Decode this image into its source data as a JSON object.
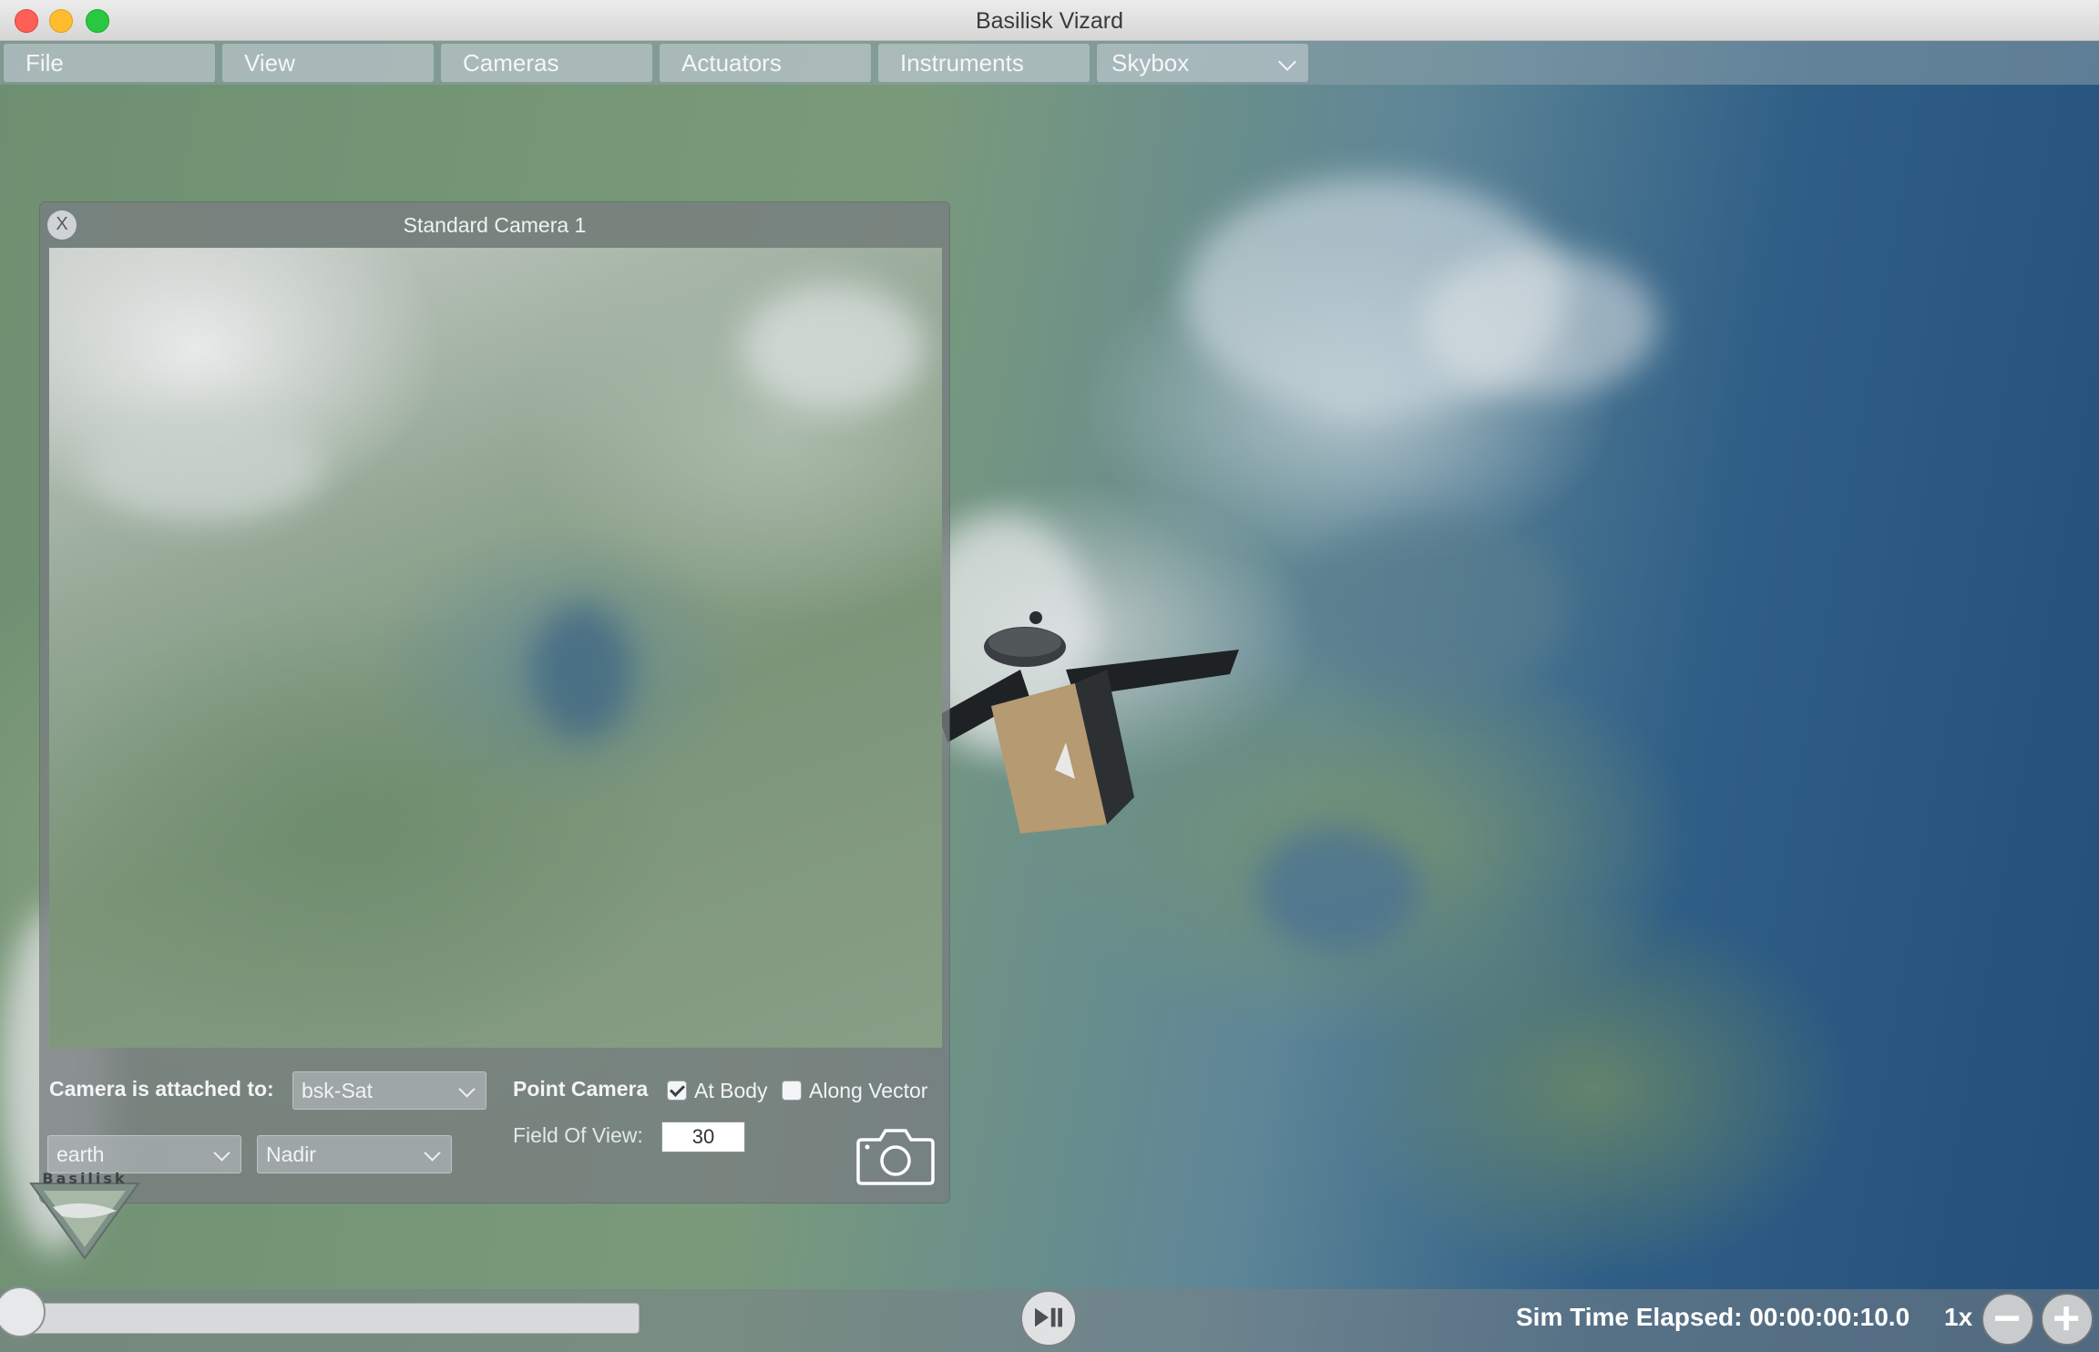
{
  "window": {
    "title": "Basilisk Vizard"
  },
  "menu": {
    "file": "File",
    "view": "View",
    "cameras": "Cameras",
    "actuators": "Actuators",
    "instruments": "Instruments",
    "skybox": "Skybox"
  },
  "camera_panel": {
    "title": "Standard Camera 1",
    "close_label": "X",
    "attached_label": "Camera is attached to:",
    "attached_value": "bsk-Sat",
    "point_camera_label": "Point Camera",
    "at_body_label": "At Body",
    "at_body_checked": true,
    "along_vector_label": "Along Vector",
    "along_vector_checked": false,
    "target_body_value": "earth",
    "pointing_mode_value": "Nadir",
    "fov_label": "Field Of View:",
    "fov_value": "30"
  },
  "logo": {
    "text": "Basilisk"
  },
  "bottom_bar": {
    "sim_time": "Sim Time Elapsed: 00:00:00:10.0",
    "speed": "1x",
    "timeline_progress": 0.0
  },
  "icons": {
    "close": "close-icon",
    "camera": "camera-icon",
    "play_pause": "play-pause-icon",
    "minus": "minus-icon",
    "plus": "plus-icon",
    "chevron": "chevron-down-icon"
  }
}
